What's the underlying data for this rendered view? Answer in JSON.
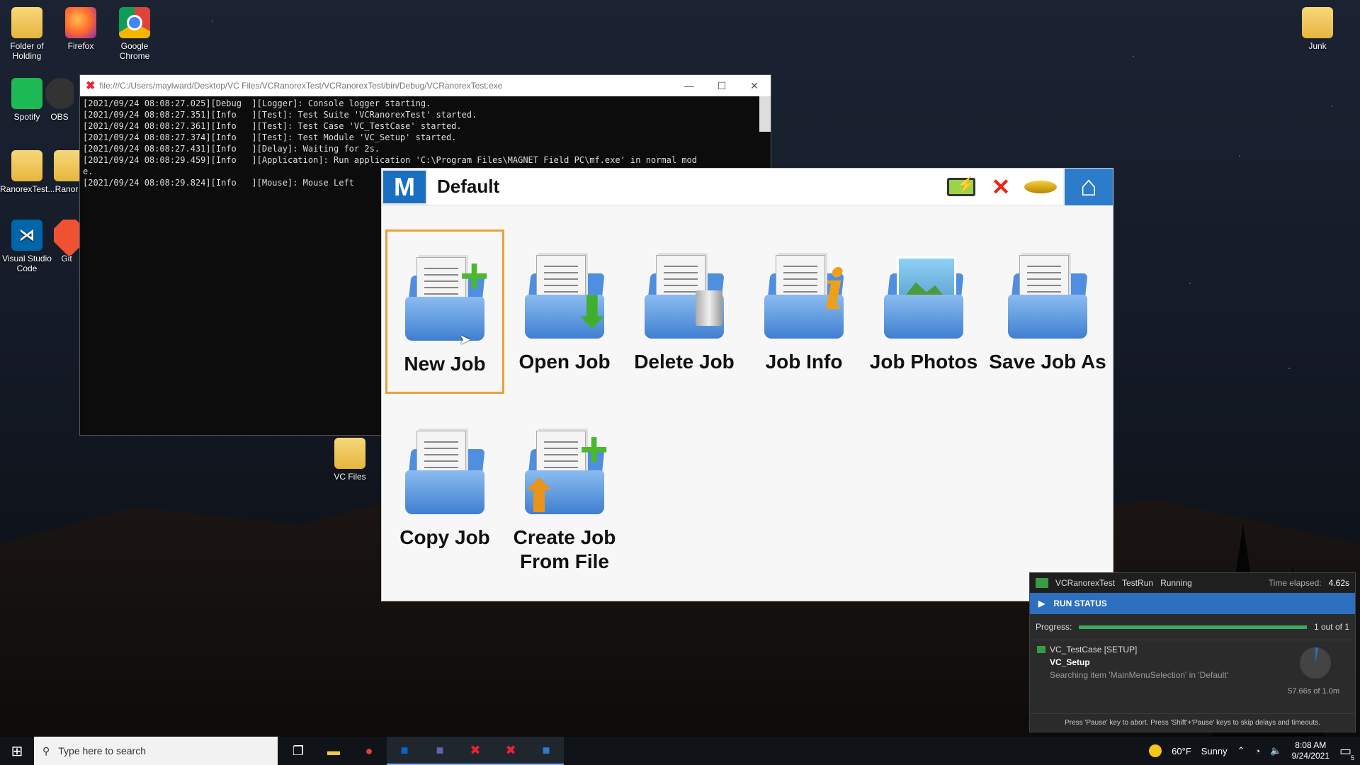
{
  "desktop": {
    "icons": [
      {
        "label": "Folder of Holding"
      },
      {
        "label": "Firefox"
      },
      {
        "label": "Google Chrome"
      },
      {
        "label": "Spotify"
      },
      {
        "label": "OBS"
      },
      {
        "label": "RanorexTest..."
      },
      {
        "label": "Ranor"
      },
      {
        "label": "Visual Studio Code"
      },
      {
        "label": "Git"
      },
      {
        "label": "VC Files"
      },
      {
        "label": "Junk"
      }
    ]
  },
  "console": {
    "title": "file:///C:/Users/maylward/Desktop/VC Files/VCRanorexTest/VCRanorexTest/bin/Debug/VCRanorexTest.exe",
    "lines": [
      "[2021/09/24 08:08:27.025][Debug  ][Logger]: Console logger starting.",
      "[2021/09/24 08:08:27.351][Info   ][Test]: Test Suite 'VCRanorexTest' started.",
      "[2021/09/24 08:08:27.361][Info   ][Test]: Test Case 'VC_TestCase' started.",
      "[2021/09/24 08:08:27.374][Info   ][Test]: Test Module 'VC_Setup' started.",
      "[2021/09/24 08:08:27.431][Info   ][Delay]: Waiting for 2s.",
      "[2021/09/24 08:08:29.459][Info   ][Application]: Run application 'C:\\Program Files\\MAGNET Field PC\\mf.exe' in normal mod",
      "e.",
      "[2021/09/24 08:08:29.824][Info   ][Mouse]: Mouse Left"
    ],
    "minimize": "—",
    "maximize": "☐",
    "close": "✕"
  },
  "app": {
    "logo": "M",
    "title": "Default",
    "tiles": [
      {
        "label": "New Job"
      },
      {
        "label": "Open Job"
      },
      {
        "label": "Delete Job"
      },
      {
        "label": "Job Info"
      },
      {
        "label": "Job Photos"
      },
      {
        "label": "Save Job As"
      },
      {
        "label": "Copy Job"
      },
      {
        "label": "Create Job From File"
      }
    ],
    "info_glyph": "i"
  },
  "run_panel": {
    "suite": "VCRanorexTest",
    "run": "TestRun",
    "state": "Running",
    "time_label": "Time elapsed:",
    "time_value": "4.62s",
    "status_label": "RUN STATUS",
    "progress_label": "Progress:",
    "progress_value": 1.0,
    "progress_text": "1 out of 1",
    "case": "VC_TestCase [SETUP]",
    "module": "VC_Setup",
    "message": "Searching item 'MainMenuSelection' in 'Default'",
    "timeout": "57.66s of 1.0m",
    "footer": "Press 'Pause' key to abort. Press 'Shift'+'Pause' keys to skip delays and timeouts."
  },
  "taskbar": {
    "search_placeholder": "Type here to search",
    "weather_temp": "60°F",
    "weather_desc": "Sunny",
    "time": "8:08 AM",
    "date": "9/24/2021",
    "notifications": "5"
  }
}
